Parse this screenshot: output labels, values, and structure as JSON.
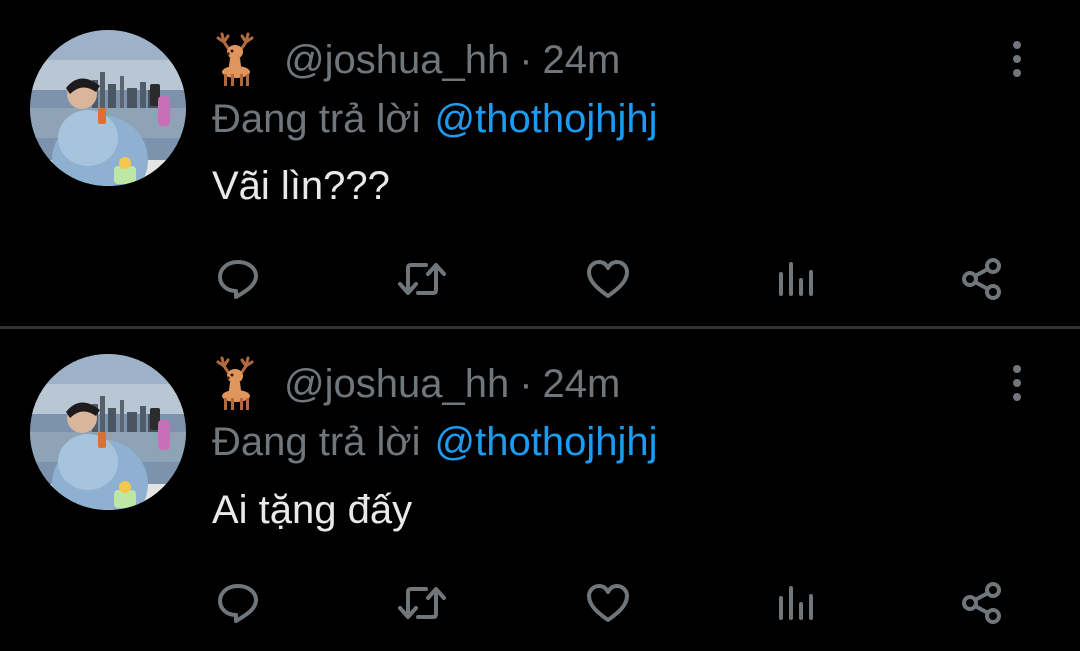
{
  "theme": {
    "background": "#000000",
    "muted": "#71767b",
    "accent": "#1d9bf0",
    "text": "#e7e9ea",
    "divider": "#2f3336"
  },
  "tweets": [
    {
      "name_emoji": "deer",
      "handle": "@joshua_hh",
      "separator": "·",
      "time": "24m",
      "reply_prefix": "Đang trả lời",
      "reply_to": "@thothojhjhj",
      "text": "Vãi lìn???",
      "actions": [
        "reply-icon",
        "retweet-icon",
        "like-icon",
        "views-icon",
        "share-icon"
      ]
    },
    {
      "name_emoji": "deer",
      "handle": "@joshua_hh",
      "separator": "·",
      "time": "24m",
      "reply_prefix": "Đang trả lời",
      "reply_to": "@thothojhjhj",
      "text": "Ai tặng đấy",
      "actions": [
        "reply-icon",
        "retweet-icon",
        "like-icon",
        "views-icon",
        "share-icon"
      ]
    }
  ]
}
